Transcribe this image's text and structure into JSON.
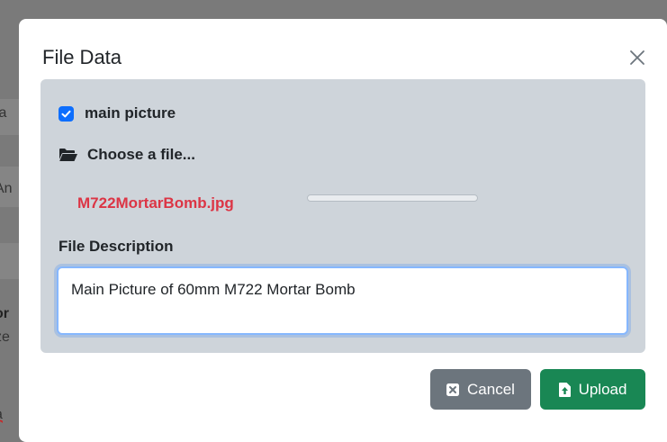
{
  "background": {
    "fragments": [
      "ta",
      "An",
      "or",
      "ze",
      "a"
    ]
  },
  "modal": {
    "title": "File Data",
    "checkbox": {
      "label": "main picture",
      "checked": true
    },
    "choose_file_label": "Choose a file...",
    "file_name": "M722MortarBomb.jpg",
    "upload_progress_percent": 0,
    "description_label": "File Description",
    "description_value": "Main Picture of 60mm M722 Mortar Bomb",
    "buttons": {
      "cancel": "Cancel",
      "upload": "Upload"
    }
  },
  "colors": {
    "accent": "#0d6efd",
    "filename": "#dc3545",
    "cancel": "#6c757d",
    "upload": "#198754",
    "panel": "#ced4da"
  },
  "icons": [
    "close-icon",
    "checkbox-check-icon",
    "folder-open-icon",
    "cancel-x-icon",
    "file-upload-icon"
  ]
}
